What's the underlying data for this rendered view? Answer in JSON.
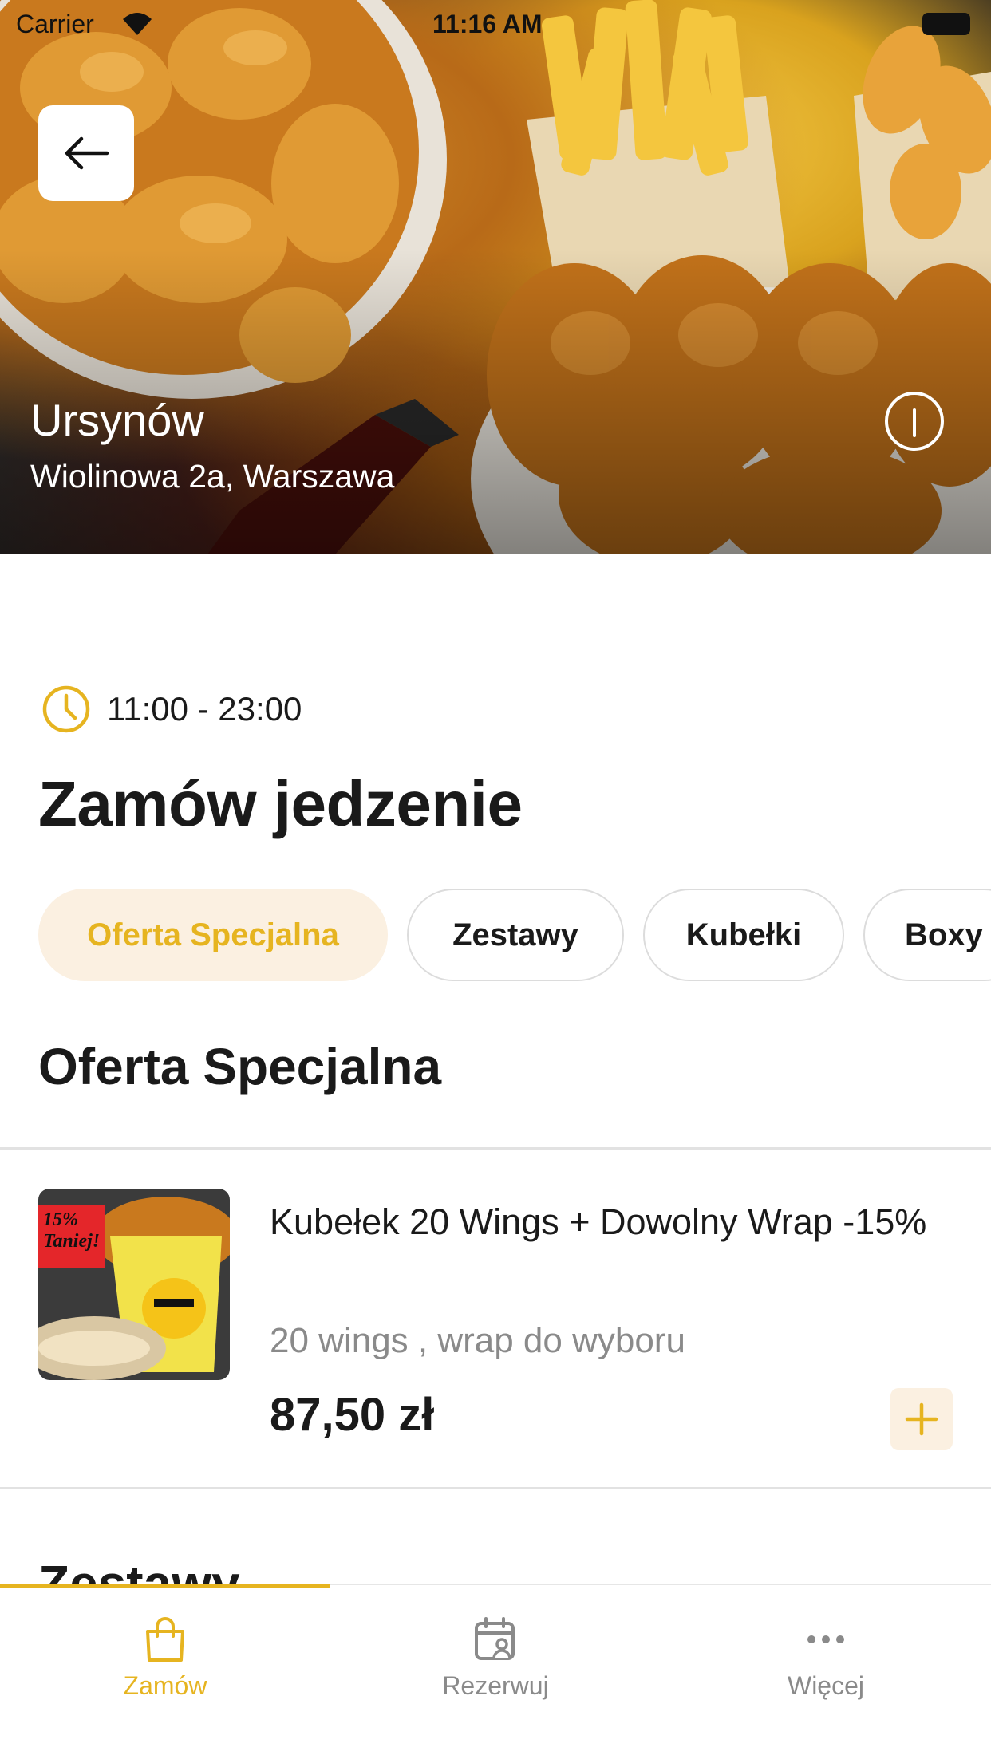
{
  "status_bar": {
    "carrier": "Carrier",
    "time": "11:16 AM"
  },
  "restaurant": {
    "name": "Ursynów",
    "address": "Wiolinowa 2a, Warszawa"
  },
  "hours": "11:00 - 23:00",
  "page_title": "Zamów jedzenie",
  "categories": [
    {
      "label": "Oferta Specjalna",
      "active": true
    },
    {
      "label": "Zestawy",
      "active": false
    },
    {
      "label": "Kubełki",
      "active": false
    },
    {
      "label": "Boxy",
      "active": false
    }
  ],
  "section": {
    "title": "Oferta Specjalna"
  },
  "items": [
    {
      "name": "Kubełek 20 Wings + Dowolny Wrap -15%",
      "description": "20 wings , wrap do wyboru",
      "price": "87,50 zł",
      "badge": "15% Taniej!"
    }
  ],
  "next_section": {
    "title": "Zestawy"
  },
  "tabbar": [
    {
      "label": "Zamów",
      "icon": "shopping-bag-icon",
      "active": true
    },
    {
      "label": "Rezerwuj",
      "icon": "calendar-person-icon",
      "active": false
    },
    {
      "label": "Więcej",
      "icon": "more-dots-icon",
      "active": false
    }
  ],
  "colors": {
    "accent": "#e6b420",
    "accent_light": "#fbf0e1",
    "text": "#1a1a1a",
    "muted": "#8a8a8a"
  }
}
